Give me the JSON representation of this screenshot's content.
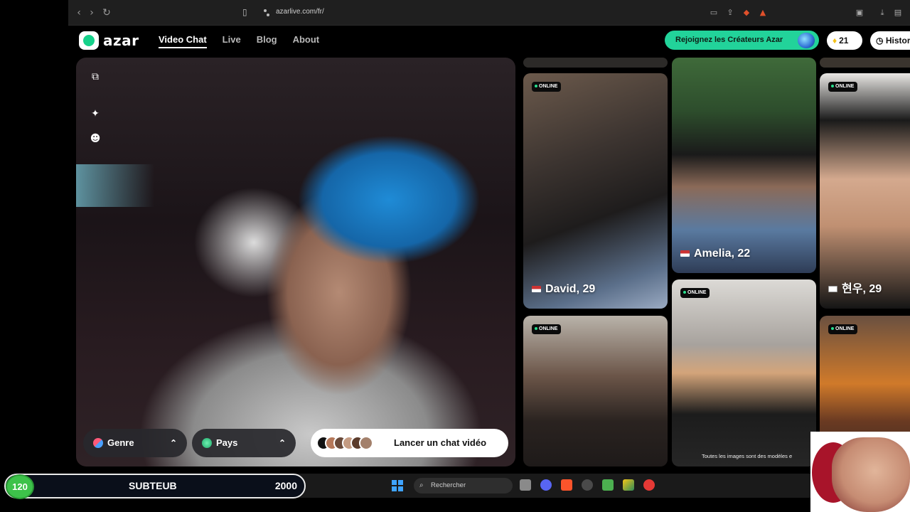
{
  "browser": {
    "url": "azarlive.com/fr/"
  },
  "nav": {
    "logo_text": "azar",
    "links": [
      "Video Chat",
      "Live",
      "Blog",
      "About"
    ],
    "cta_label": "Rejoignez les Créateurs Azar",
    "gems_count": "21",
    "history_label": "Histor"
  },
  "video": {
    "genre_label": "Genre",
    "pays_label": "Pays",
    "launch_label": "Lancer un chat vidéo"
  },
  "profiles": [
    {
      "status": "ONLINE",
      "name": "David, 29"
    },
    {
      "status": "",
      "name": "Amelia, 22"
    },
    {
      "status": "ONLINE",
      "name": "현우, 29"
    },
    {
      "status": "ONLINE",
      "name": ""
    },
    {
      "status": "ONLINE",
      "name": "",
      "note": "Toutes les images sont des modèles e"
    },
    {
      "status": "ONLINE",
      "name": ""
    }
  ],
  "taskbar": {
    "search_placeholder": "Rechercher"
  },
  "overlay": {
    "sub_count": "120",
    "sub_label": "SUBTEUB",
    "sub_goal": "2000"
  },
  "colors": {
    "brand_green": "#22d39a",
    "online_dot": "#29e08e",
    "sub_green": "#3dc24a"
  }
}
